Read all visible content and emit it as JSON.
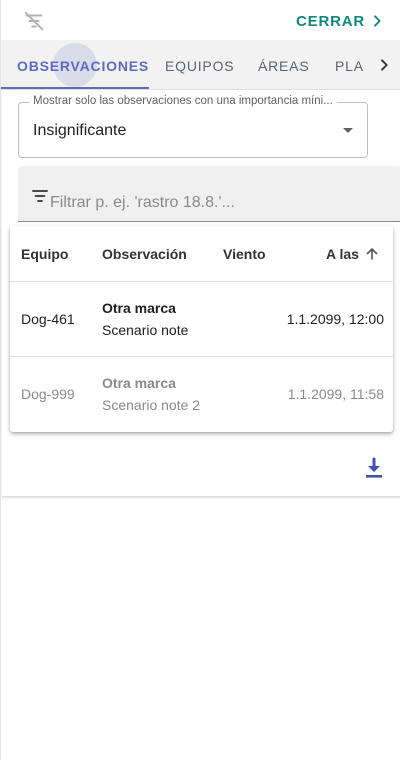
{
  "toolbar": {
    "filter_off_icon": "filter-off-icon",
    "close_label": "CERRAR",
    "close_icon": "chevron-right-icon"
  },
  "tabs": {
    "items": [
      {
        "label": "OBSERVACIONES",
        "active": true
      },
      {
        "label": "EQUIPOS",
        "active": false
      },
      {
        "label": "ÁREAS",
        "active": false
      },
      {
        "label": "PLA",
        "active": false
      }
    ],
    "scroll_icon": "chevron-right-icon"
  },
  "importance_select": {
    "label": "Mostrar solo las observaciones con una importancia míni...",
    "value": "Insignificante"
  },
  "filter": {
    "icon": "filter-list-icon",
    "placeholder": "Filtrar p. ej. 'rastro 18.8.'..."
  },
  "table": {
    "headers": {
      "team": "Equipo",
      "observation": "Observación",
      "wind": "Viento",
      "time": "A las",
      "sort_icon": "arrow-up-icon"
    },
    "rows": [
      {
        "team": "Dog-461",
        "title": "Otra marca",
        "note": "Scenario note",
        "wind": "",
        "time": "1.1.2099, 12:00"
      },
      {
        "team": "Dog-999",
        "title": "Otra marca",
        "note": "Scenario note 2",
        "wind": "",
        "time": "1.1.2099, 11:58"
      }
    ]
  },
  "download_icon": "download-icon",
  "colors": {
    "accent": "#5c6bc0",
    "close": "#0e8a7d",
    "tab_bg": "#f2f2f2",
    "muted_text": "#8a8a8a"
  }
}
